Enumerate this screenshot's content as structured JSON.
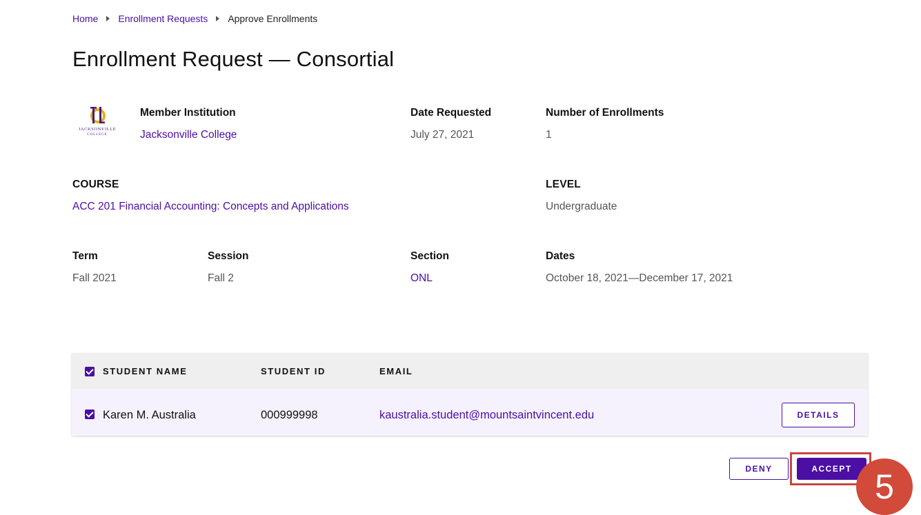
{
  "breadcrumb": {
    "items": [
      "Home",
      "Enrollment Requests"
    ],
    "current": "Approve Enrollments"
  },
  "page": {
    "title": "Enrollment Request — Consortial"
  },
  "institution": {
    "label": "Member Institution",
    "value": "Jacksonville College",
    "logo_text_top": "JACKSONVILLE",
    "logo_text_bottom": "COLLEGE"
  },
  "date_requested": {
    "label": "Date Requested",
    "value": "July 27, 2021"
  },
  "num_enrollments": {
    "label": "Number of Enrollments",
    "value": "1"
  },
  "course": {
    "label": "COURSE",
    "value": "ACC 201 Financial Accounting: Concepts and Applications"
  },
  "level": {
    "label": "LEVEL",
    "value": "Undergraduate"
  },
  "term": {
    "label": "Term",
    "value": "Fall 2021"
  },
  "session": {
    "label": "Session",
    "value": "Fall 2"
  },
  "section": {
    "label": "Section",
    "value": "ONL"
  },
  "dates": {
    "label": "Dates",
    "value": "October 18, 2021—December 17, 2021"
  },
  "table": {
    "columns": [
      "STUDENT NAME",
      "STUDENT ID",
      "EMAIL"
    ],
    "rows": [
      {
        "name": "Karen M. Australia",
        "id": "000999998",
        "email": "kaustralia.student@mountsaintvincent.edu",
        "details_label": "DETAILS"
      }
    ]
  },
  "actions": {
    "deny_label": "DENY",
    "accept_label": "ACCEPT"
  },
  "annotation": {
    "step": "5"
  },
  "colors": {
    "accent": "#4b0fa3",
    "highlight": "#c8453f",
    "badge": "#d14a3a"
  }
}
